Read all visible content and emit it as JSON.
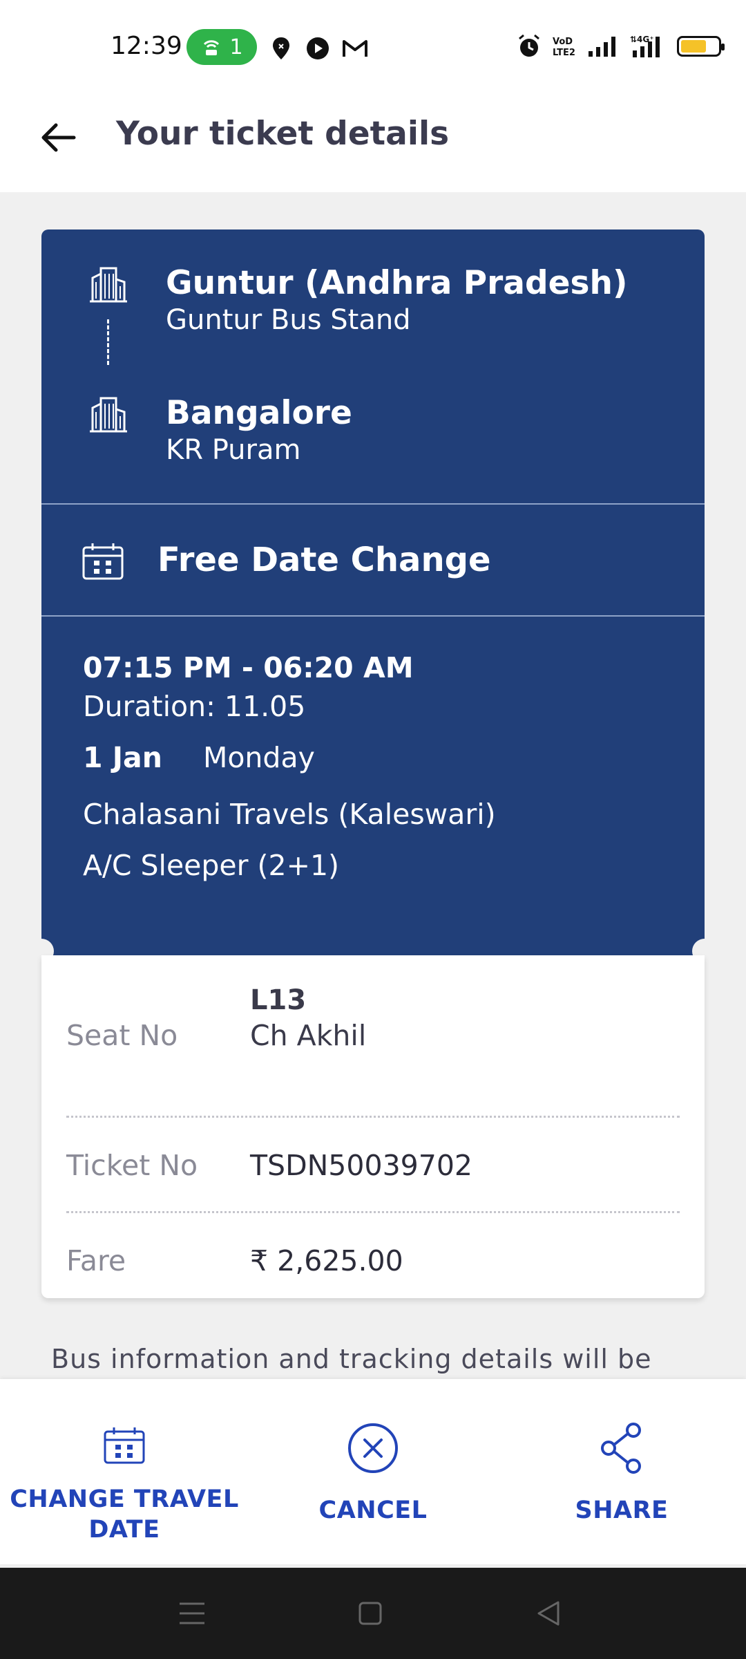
{
  "status_bar": {
    "time": "12:39",
    "hotspot_count": "1",
    "battery_color": "#f5c228"
  },
  "header": {
    "title": "Your ticket details",
    "back_icon": "arrow-left-icon"
  },
  "ticket": {
    "origin": {
      "city": "Guntur (Andhra Pradesh)",
      "stop": "Guntur Bus Stand"
    },
    "destination": {
      "city": "Bangalore",
      "stop": "KR Puram"
    },
    "free_date_change": "Free Date Change",
    "time_range": "07:15 PM - 06:20 AM",
    "duration": "Duration: 11.05",
    "date": "1 Jan",
    "day": "Monday",
    "operator": "Chalasani Travels (Kaleswari)",
    "bus_type": "A/C Sleeper (2+1)",
    "seat_label": "Seat No",
    "seat_no": "L13",
    "passenger": "Ch Akhil",
    "ticket_label": "Ticket No",
    "ticket_no": "TSDN50039702",
    "fare_label": "Fare",
    "fare": "₹ 2,625.00"
  },
  "info_text": "Bus information and tracking details will be",
  "actions": {
    "change_date_line1": "CHANGE TRAVEL",
    "change_date_line2": "DATE",
    "cancel": "CANCEL",
    "share": "SHARE"
  },
  "colors": {
    "ticket_blue": "#213f79",
    "action_blue": "#2244b8"
  }
}
